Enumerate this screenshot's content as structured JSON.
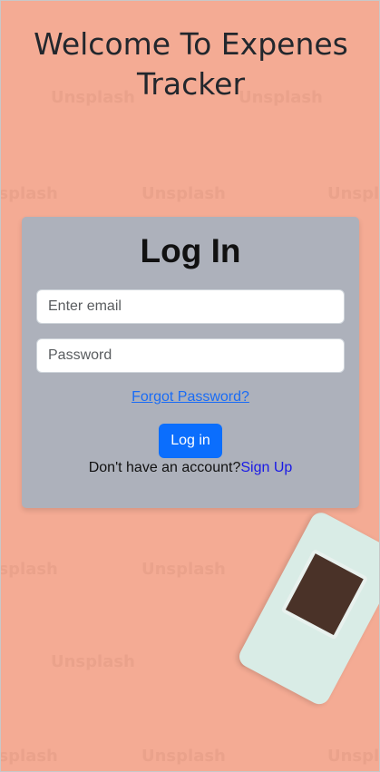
{
  "page": {
    "heading": "Welcome To Expenes Tracker",
    "watermark": "Unsplash"
  },
  "login": {
    "title": "Log In",
    "email_placeholder": "Enter email",
    "password_placeholder": "Password",
    "forgot_link": "Forgot Password?",
    "submit_label": "Log in",
    "signup_prompt": "Don't have an account?",
    "signup_link": "Sign Up"
  },
  "colors": {
    "background": "#f4ab94",
    "card": "#adb1bb",
    "primary_button": "#0b6efd",
    "link": "#1a6cf5"
  }
}
